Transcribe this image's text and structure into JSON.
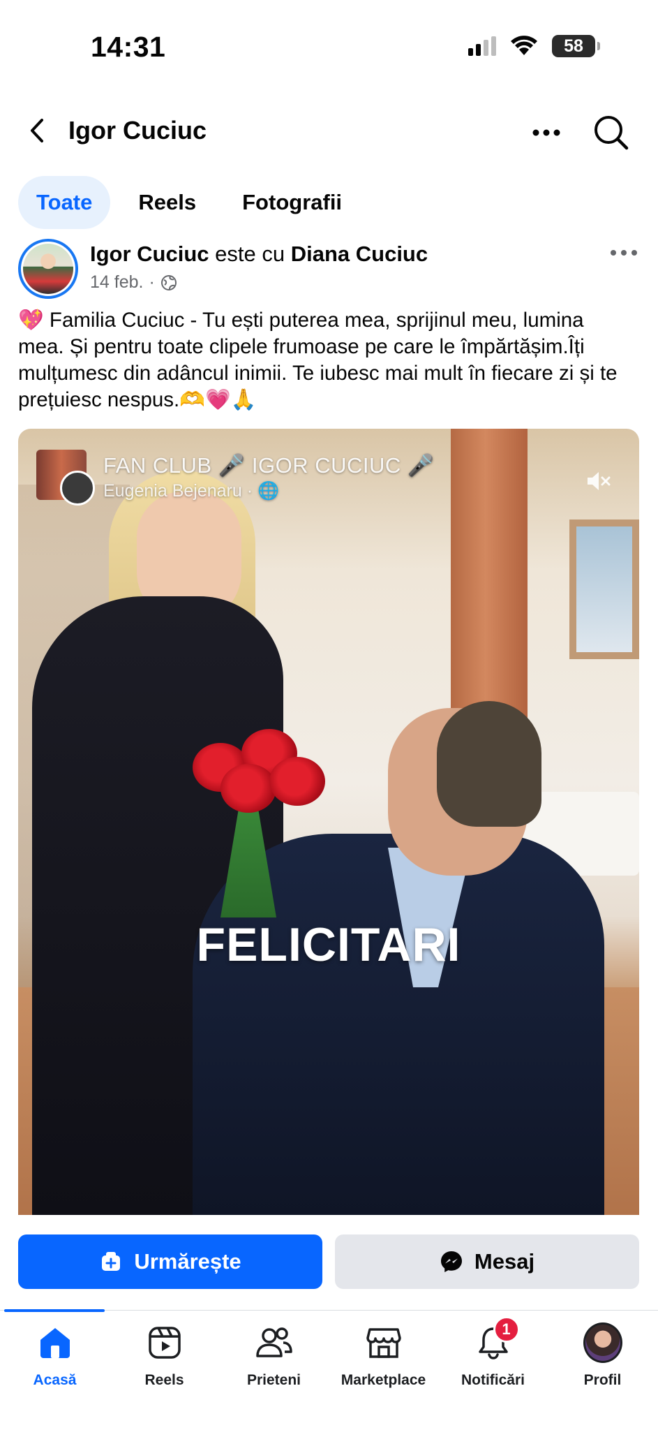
{
  "status_bar": {
    "time": "14:31",
    "battery": "58"
  },
  "header": {
    "title": "Igor Cuciuc"
  },
  "tabs": [
    {
      "label": "Toate",
      "active": true
    },
    {
      "label": "Reels",
      "active": false
    },
    {
      "label": "Fotografii",
      "active": false
    }
  ],
  "post": {
    "author": "Igor Cuciuc",
    "connector": "este cu",
    "tagged": "Diana  Cuciuc",
    "date": "14 feb.",
    "text": "💖 Familia Cuciuc  - Tu ești puterea mea, sprijinul meu, lumina mea. Și pentru toate clipele frumoase pe care le împărtășim.Îți mulțumesc din adâncul inimii. Te iubesc mai mult în fiecare zi și te prețuiesc nespus.🫶💗🙏",
    "video": {
      "source_name": "FAN CLUB 🎤  IGOR CUCIUC 🎤",
      "source_sub": "Eugenia Bejenaru ·",
      "caption": "FELICITARI"
    }
  },
  "actions": {
    "follow_label": "Urmărește",
    "message_label": "Mesaj"
  },
  "bottom_nav": [
    {
      "label": "Acasă",
      "icon": "home-icon",
      "active": true
    },
    {
      "label": "Reels",
      "icon": "reels-icon",
      "active": false
    },
    {
      "label": "Prieteni",
      "icon": "friends-icon",
      "active": false
    },
    {
      "label": "Marketplace",
      "icon": "marketplace-icon",
      "active": false
    },
    {
      "label": "Notificări",
      "icon": "bell-icon",
      "active": false,
      "badge": "1"
    },
    {
      "label": "Profil",
      "icon": "avatar",
      "active": false
    }
  ],
  "colors": {
    "accent": "#0866ff",
    "tab_active_bg": "#e7f1fd",
    "secondary_button": "#e4e6eb",
    "badge": "#e41e3f",
    "meta_text": "#65676b"
  }
}
